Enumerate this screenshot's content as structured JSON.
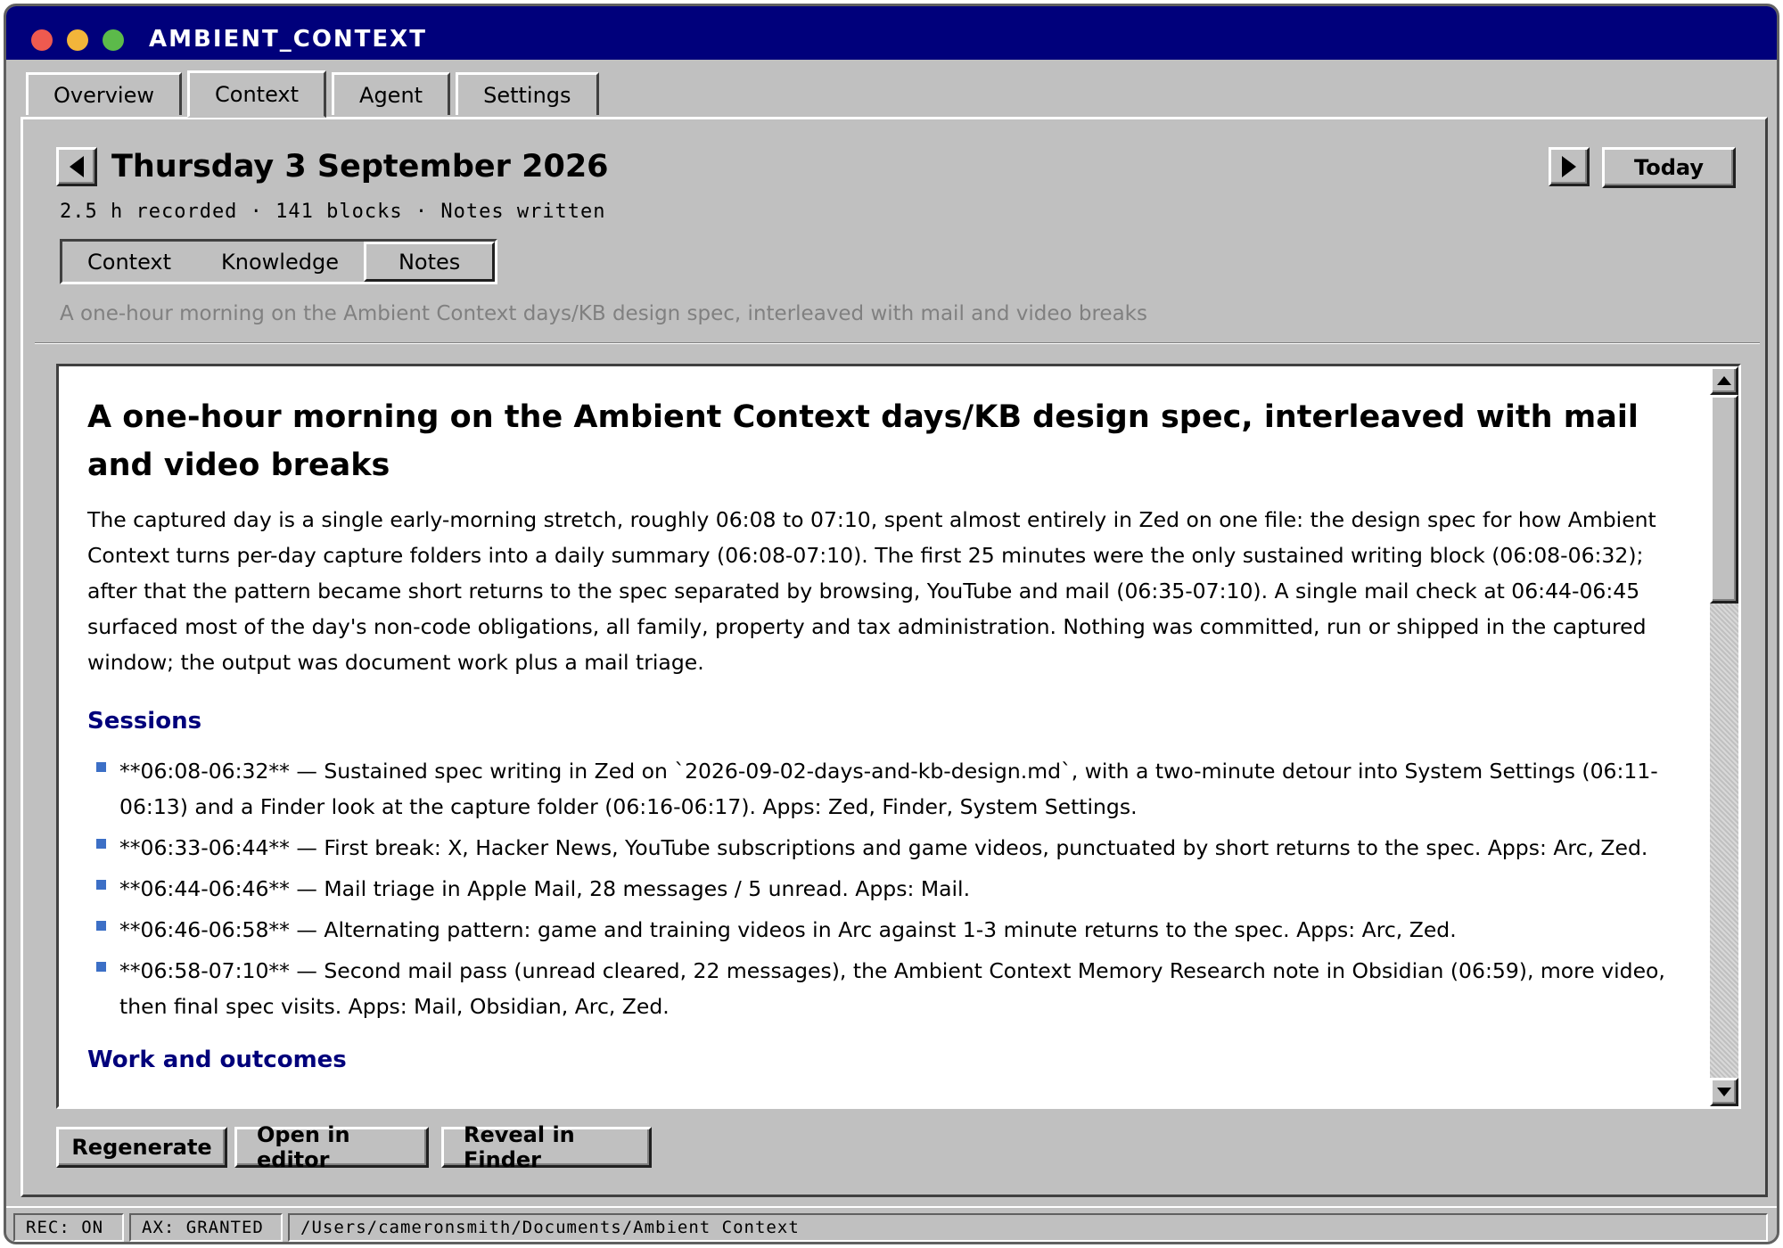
{
  "app": {
    "title": "AMBIENT_CONTEXT"
  },
  "colors": {
    "titlebar": "#00007b",
    "light_red": "#ee5a4f",
    "light_yellow": "#f3b53a",
    "light_green": "#5cba4a",
    "accent": "#00007b",
    "bullet": "#3c6fc6"
  },
  "tabs": [
    {
      "label": "Overview"
    },
    {
      "label": "Context"
    },
    {
      "label": "Agent"
    },
    {
      "label": "Settings"
    }
  ],
  "active_tab": "Context",
  "day": {
    "date": "Thursday 3 September 2026",
    "meta": "2.5 h recorded · 141 blocks · Notes written",
    "today_label": "Today",
    "prev_icon": "triangle-left-icon",
    "next_icon": "triangle-right-icon"
  },
  "segments": [
    {
      "label": "Context"
    },
    {
      "label": "Knowledge"
    },
    {
      "label": "Notes"
    }
  ],
  "selected_segment": "Notes",
  "subtitle": "A one-hour morning on the Ambient Context days/KB design spec, interleaved with mail and video breaks",
  "document": {
    "heading": "A one-hour morning on the Ambient Context days/KB design spec, interleaved with mail and video breaks",
    "paragraph": "The captured day is a single early-morning stretch, roughly 06:08 to 07:10, spent almost entirely in Zed on one file: the design spec for how Ambient Context turns per-day capture folders into a daily summary (06:08-07:10). The first 25 minutes were the only sustained writing block (06:08-06:32); after that the pattern became short returns to the spec separated by browsing, YouTube and mail (06:35-07:10). A single mail check at 06:44-06:45 surfaced most of the day's non-code obligations, all family, property and tax administration. Nothing was committed, run or shipped in the captured window; the output was document work plus a mail triage.",
    "sessions_heading": "Sessions",
    "sessions": [
      "**06:08-06:32** — Sustained spec writing in Zed on `2026-09-02-days-and-kb-design.md`, with a two-minute detour into System Settings (06:11-06:13) and a Finder look at the capture folder (06:16-06:17). Apps: Zed, Finder, System Settings.",
      "**06:33-06:44** — First break: X, Hacker News, YouTube subscriptions and game videos, punctuated by short returns to the spec. Apps: Arc, Zed.",
      "**06:44-06:46** — Mail triage in Apple Mail, 28 messages / 5 unread. Apps: Mail.",
      "**06:46-06:58** — Alternating pattern: game and training videos in Arc against 1-3 minute returns to the spec. Apps: Arc, Zed.",
      "**06:58-07:10** — Second mail pass (unread cleared, 22 messages), the Ambient Context Memory Research note in Obsidian (06:59), more video, then final spec visits. Apps: Mail, Obsidian, Arc, Zed."
    ],
    "work_heading": "Work and outcomes"
  },
  "actions": {
    "regenerate": "Regenerate",
    "open_editor": "Open in editor",
    "reveal_finder": "Reveal in Finder"
  },
  "status": {
    "rec": "REC: ON",
    "ax": "AX: GRANTED",
    "path": "/Users/cameronsmith/Documents/Ambient Context"
  }
}
